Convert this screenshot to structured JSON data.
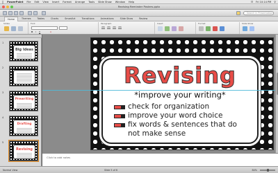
{
  "menubar": {
    "app": "PowerPoint",
    "items": [
      "File",
      "Edit",
      "View",
      "Insert",
      "Format",
      "Arrange",
      "Tools",
      "Slide Show",
      "Window",
      "Help"
    ],
    "clock": "Fri 10:14 PM"
  },
  "window": {
    "title": "Revising Reminder Posters.pptx"
  },
  "toolbar": {
    "search_placeholder": "Search in Presentation"
  },
  "ribbon": {
    "tabs": [
      "Home",
      "Themes",
      "Tables",
      "Charts",
      "SmartArt",
      "Transitions",
      "Animations",
      "Slide Show",
      "Review"
    ],
    "active_tab": "Home",
    "groups": [
      "Slides",
      "Font",
      "Paragraph",
      "Insert",
      "Format",
      "Slide Show"
    ]
  },
  "sidebar": {
    "slides": [
      {
        "num": "1",
        "title": "Big Ideas",
        "selected": false
      },
      {
        "num": "2",
        "title": "",
        "selected": false
      },
      {
        "num": "3",
        "title": "Prewriting",
        "selected": false
      },
      {
        "num": "4",
        "title": "Drafting",
        "selected": false
      },
      {
        "num": "5",
        "title": "Revising",
        "selected": true
      }
    ]
  },
  "slide": {
    "title": "Revising",
    "subtitle": "*improve your writing*",
    "bullets": [
      "check for organization",
      "improve your word choice",
      "fix words & sentences that do",
      "not make sense"
    ]
  },
  "notes": {
    "placeholder": "Click to add notes"
  },
  "statusbar": {
    "view": "Normal View",
    "slide_info": "Slide 5 of 6",
    "zoom": "84%"
  },
  "colors": {
    "title_red": "#e84c47",
    "selection_orange": "#e58a1f",
    "guide_cyan": "#4fb9d8"
  }
}
